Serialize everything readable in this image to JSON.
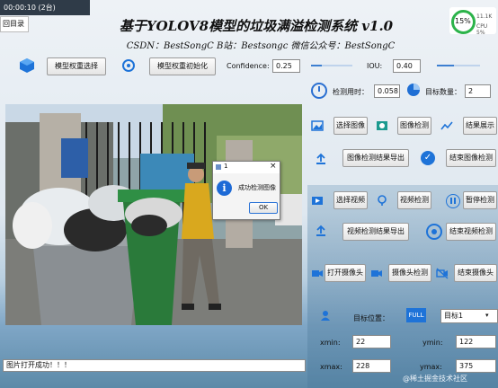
{
  "titlebar": {
    "time_text": "00:00:10 (2台)",
    "menu_tab": "回目录"
  },
  "header": {
    "title": "基于YOLOV8模型的垃圾满溢检测系统 v1.0",
    "subtitle": "CSDN：BestSongC   B站：Bestsongc   微信公众号：BestSongC"
  },
  "toolbar": {
    "select_model": "模型权重选择",
    "init_model": "模型权重初始化",
    "confidence_label": "Confidence:",
    "confidence_value": "0.25",
    "confidence_level": 0.25,
    "iou_label": "IOU:",
    "iou_value": "0.40",
    "iou_level": 0.4
  },
  "stats": {
    "time_label": "检测用时：",
    "time_value": "0.058",
    "count_label": "目标数量：",
    "count_value": "2"
  },
  "image_ops": {
    "select_image": "选择图像",
    "detect_image": "图像检测",
    "show_result": "结果展示",
    "export_image": "图像检测结果导出",
    "end_image": "结束图像检测"
  },
  "video_ops": {
    "select_video": "选择视频",
    "detect_video": "视频检测",
    "pause": "暂停检测",
    "export_video": "视频检测结果导出",
    "end_video": "结束视频检测"
  },
  "camera_ops": {
    "open_camera": "打开摄像头",
    "detect_camera": "摄像头检测",
    "end_camera": "结束摄像头"
  },
  "target": {
    "position_label": "目标位置：",
    "badge_text": "FULL",
    "select_value": "目标1",
    "xmin_label": "xmin:",
    "xmin_value": "22",
    "ymin_label": "ymin:",
    "ymin_value": "122",
    "xmax_label": "xmax:",
    "xmax_value": "228",
    "ymax_label": "ymax:",
    "ymax_value": "375"
  },
  "status_bar": {
    "text": "图片打开成功！！！"
  },
  "dialog": {
    "title": "1",
    "message": "成功检测图像",
    "ok_label": "OK"
  },
  "perf_widget": {
    "percent": "15%",
    "cpu_text": "CPU 5%",
    "net_text": "11.1K"
  },
  "watermark": "@稀土掘金技术社区",
  "colors": {
    "accent": "#3d7fd1",
    "title": "#111111",
    "ring": "#2cb34a"
  }
}
